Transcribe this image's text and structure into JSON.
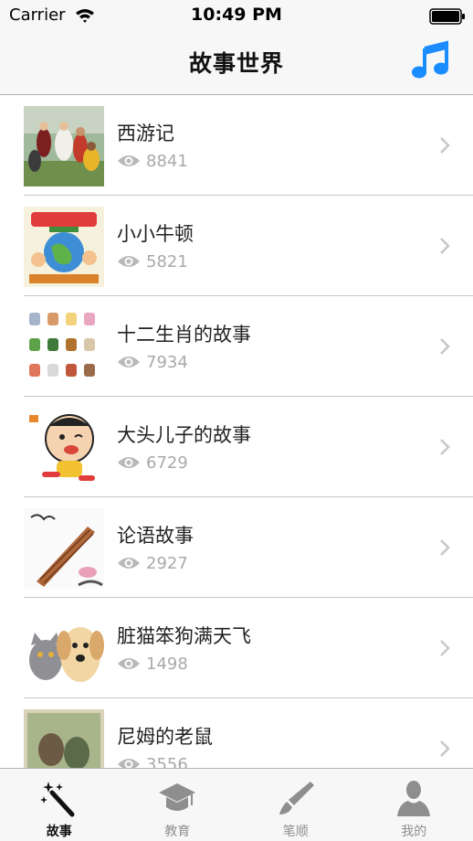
{
  "status_bar": {
    "carrier": "Carrier",
    "time": "10:49 PM"
  },
  "nav": {
    "title": "故事世界",
    "music_icon": "music-note-icon"
  },
  "colors": {
    "accent": "#1a8cff",
    "muted_text": "#a9a9a9",
    "separator": "#c8c7cc",
    "bar_background": "#f7f7f7"
  },
  "stories": [
    {
      "title": "西游记",
      "views": "8841",
      "thumb": "journey-west-cast-photo"
    },
    {
      "title": "小小牛顿",
      "views": "5821",
      "thumb": "little-newton-book-cover"
    },
    {
      "title": "十二生肖的故事",
      "views": "7934",
      "thumb": "zodiac-animals-grid"
    },
    {
      "title": "大头儿子的故事",
      "views": "6729",
      "thumb": "big-head-son-cartoon"
    },
    {
      "title": "论语故事",
      "views": "2927",
      "thumb": "bamboo-scroll-ink"
    },
    {
      "title": "脏猫笨狗满天飞",
      "views": "1498",
      "thumb": "cat-and-puppy"
    },
    {
      "title": "尼姆的老鼠",
      "views": "3556",
      "thumb": "nimh-rats-cover"
    }
  ],
  "tabs": [
    {
      "label": "故事",
      "icon": "magic-wand-icon",
      "active": true
    },
    {
      "label": "教育",
      "icon": "graduation-cap-icon",
      "active": false
    },
    {
      "label": "笔顺",
      "icon": "brush-icon",
      "active": false
    },
    {
      "label": "我的",
      "icon": "person-icon",
      "active": false
    }
  ]
}
